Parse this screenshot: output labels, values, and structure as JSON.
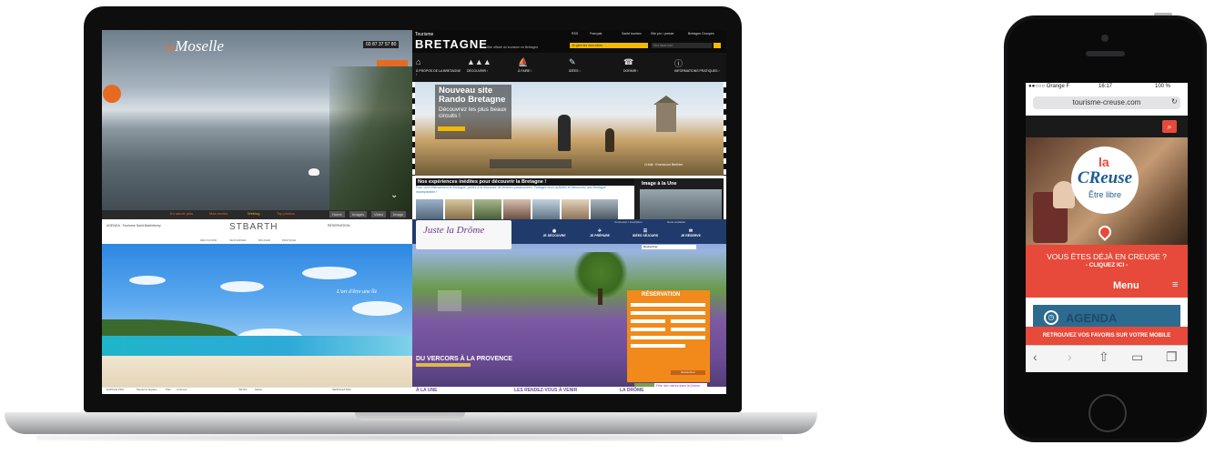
{
  "moselle": {
    "logo_la": "la",
    "logo_name": "Moselle",
    "tagline": "",
    "phone": "03 87 37 57 80",
    "badge": "",
    "tag": "",
    "links": [
      {
        "label": "En savoir plus",
        "color": "#e76a21"
      },
      {
        "label": "Mes envies",
        "color": "#e76a21"
      },
      {
        "label": "Weblog",
        "color": "#f1b400"
      },
      {
        "label": "Top photos",
        "color": "#e76a21"
      }
    ],
    "nav": [
      "Home",
      "Images",
      "Video",
      "Image"
    ]
  },
  "bretagne": {
    "brand_small": "Tourisme",
    "brand": "BRETAGNE",
    "subtitle": "Site officiel du tourisme en Bretagne",
    "top_links": [
      "RSS",
      "Français",
      "Santé tourism",
      "Site pro / presse",
      "Bretagne Groupes"
    ],
    "search_placeholder": "Je gère les mes idées",
    "search2_placeholder": "Mot dans tout",
    "nav": [
      {
        "icon": "⌂",
        "label": "À PROPOS DE LA BRETAGNE ›"
      },
      {
        "icon": "▲▲▲",
        "label": "DÉCOUVRIR ›"
      },
      {
        "icon": "⛵",
        "label": "À FAIRE ›"
      },
      {
        "icon": "✎",
        "label": "IDÉES ›"
      },
      {
        "icon": "☎",
        "label": "DORMIR ›"
      },
      {
        "icon": "ⓘ",
        "label": "INFORMATIONS PRATIQUES ›"
      }
    ],
    "hero_title": "Nouveau site Rando Bretagne",
    "hero_sub": "Découvrez les plus beaux circuits !",
    "hero_credit": "Crédit : Emmanuel Berthier",
    "lower_title": "Nos expériences inédites pour découvrir la Bretagne !",
    "lower_text": "Pour vivre intensément la Bretagne, partez à la rencontre de femmes passionnées. Partagez leurs activités et découvrez une Bretagne incomparable !",
    "image_une": "Image à la Une"
  },
  "stbarth": {
    "left_label": "AGENDA · Tourisme Saint-Barthélemy",
    "logo": "STBARTH",
    "nav": [
      "DÉCOUVRIR",
      "SÉJOURNER",
      "BOUGER",
      "PRATIQUE"
    ],
    "right_label": "RÉSERVATION",
    "tagline": "L'art d'être une île",
    "footer": [
      "ESPACE PRO",
      "Mentions légales",
      "Plan",
      "Archives",
      "INFOS",
      "Météo",
      "NEWSLETTER"
    ]
  },
  "drome": {
    "logo": "Juste la Drôme",
    "top_links": [
      "Connexion / Inscription",
      "Nous contacter"
    ],
    "nav": [
      {
        "icon": "◉",
        "label": "JE DÉCOUVRE"
      },
      {
        "icon": "✈",
        "label": "JE PRÉPARE"
      },
      {
        "icon": "☰",
        "label": "IDÉES SÉJOURS"
      },
      {
        "icon": "✉",
        "label": "JE RÉSERVE"
      }
    ],
    "search_placeholder": "Rechercher",
    "reservation_title": "RÉSERVATION",
    "reservation_button": "Rechercher",
    "banner": "DU VERCORS À LA PROVENCE",
    "fete": "Fête des mères dans la Drôme",
    "bottom": [
      "À LA UNE",
      "LES RENDEZ-VOUS À VENIR",
      "LA DRÔME"
    ]
  },
  "phone": {
    "carrier": "●●○○○ Orange F",
    "time": "16:17",
    "battery": "100 %",
    "url": "tourisme-creuse.com",
    "logo_la": "la",
    "logo_name": "CReuse",
    "logo_tag": "Être libre",
    "red_title": "VOUS ÊTES DÉJÀ EN CREUSE ?",
    "red_sub": "- CLIQUEZ ICI -",
    "menu": "Menu",
    "agenda": "AGENDA",
    "favorites": "RETROUVEZ VOS FAVORIS SUR VOTRE MOBILE",
    "accent": "#e74a3a"
  }
}
